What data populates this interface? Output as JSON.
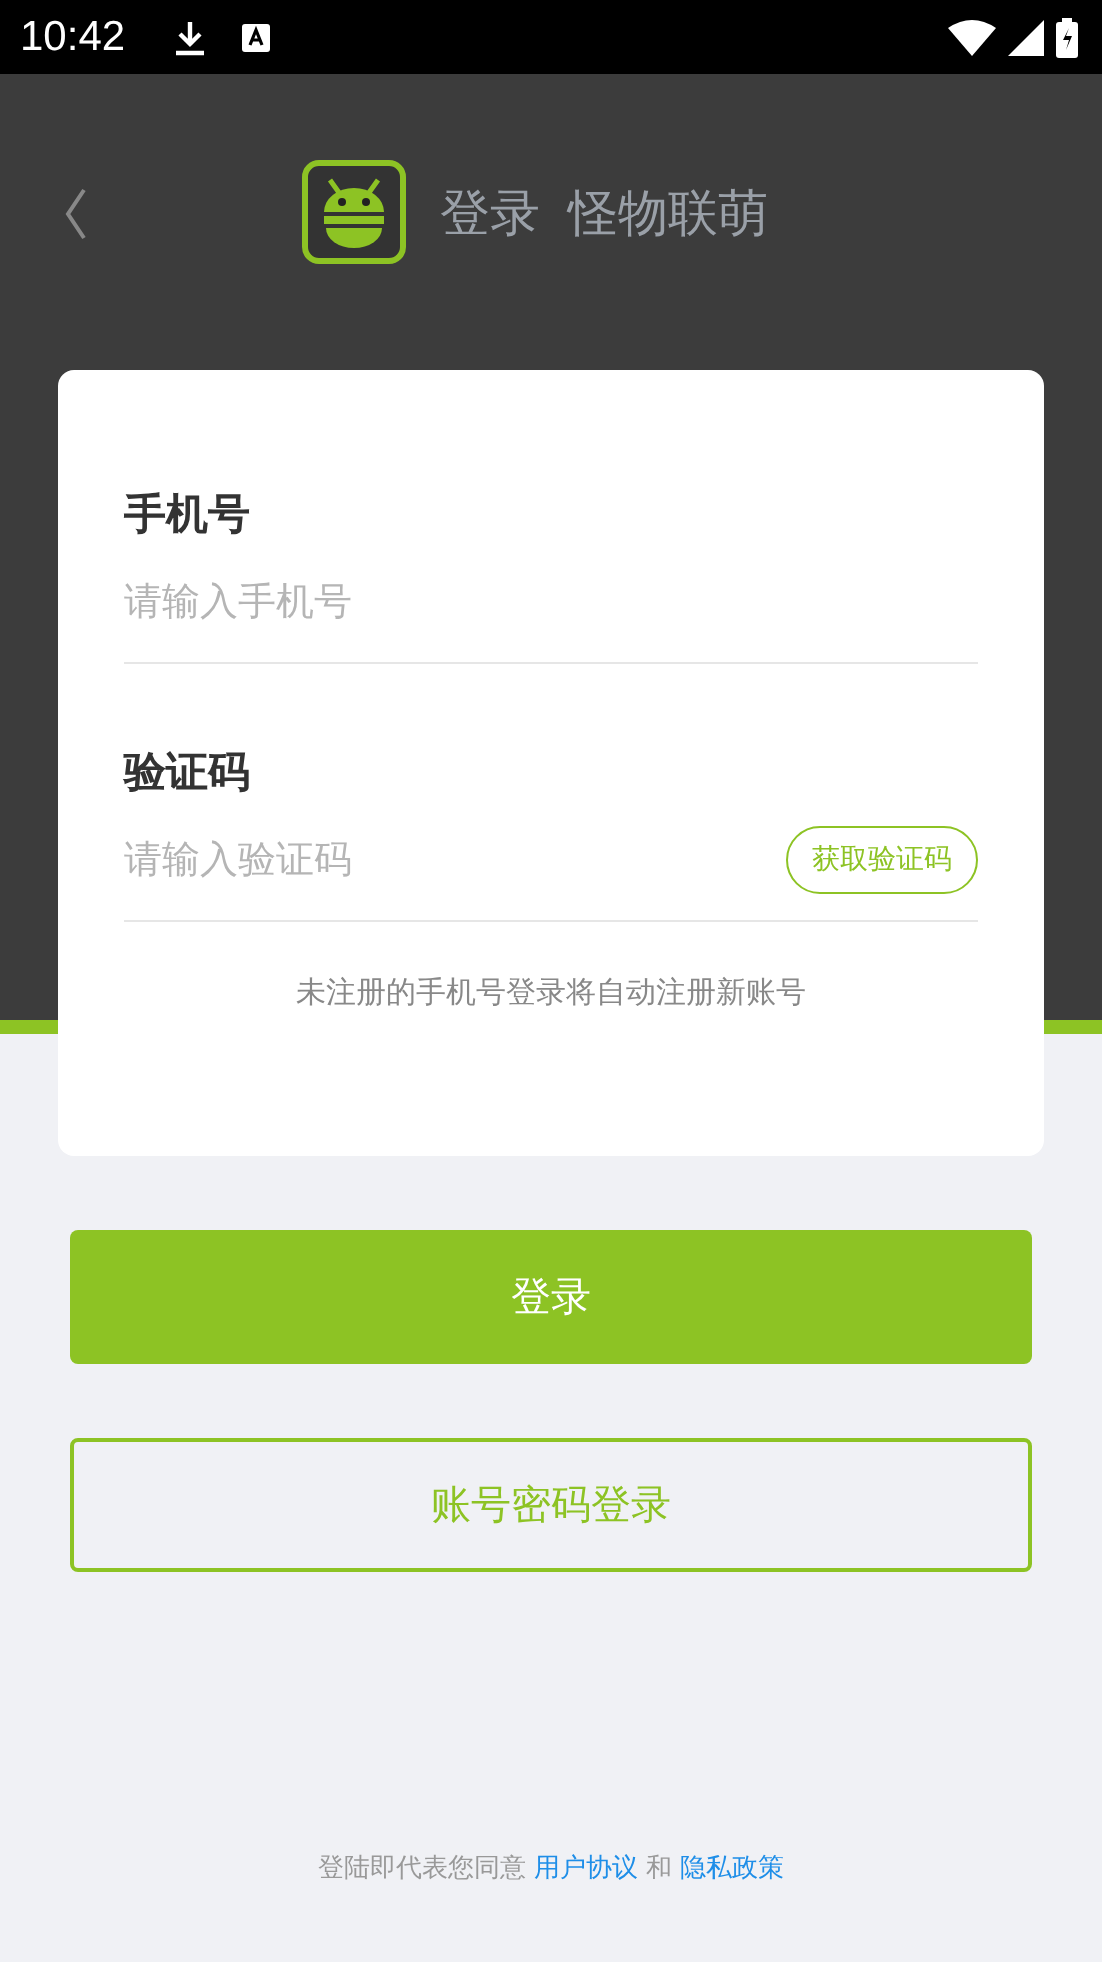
{
  "status_bar": {
    "time": "10:42"
  },
  "header": {
    "title": "登录",
    "app_name": "怪物联萌"
  },
  "form": {
    "fields": [
      {
        "kind": "text",
        "label": "手机号",
        "placeholder": "请输入手机号"
      },
      {
        "kind": "code",
        "label": "验证码",
        "placeholder": "请输入验证码",
        "action": "获取验证码"
      }
    ],
    "note": "未注册的手机号登录将自动注册新账号"
  },
  "buttons": [
    {
      "kind": "primary",
      "label": "登录"
    },
    {
      "kind": "outline",
      "label": "账号密码登录"
    }
  ],
  "footer": {
    "prefix": "登陆即代表您同意",
    "links": [
      "用户协议",
      "隐私政策"
    ],
    "joiner": "和"
  }
}
